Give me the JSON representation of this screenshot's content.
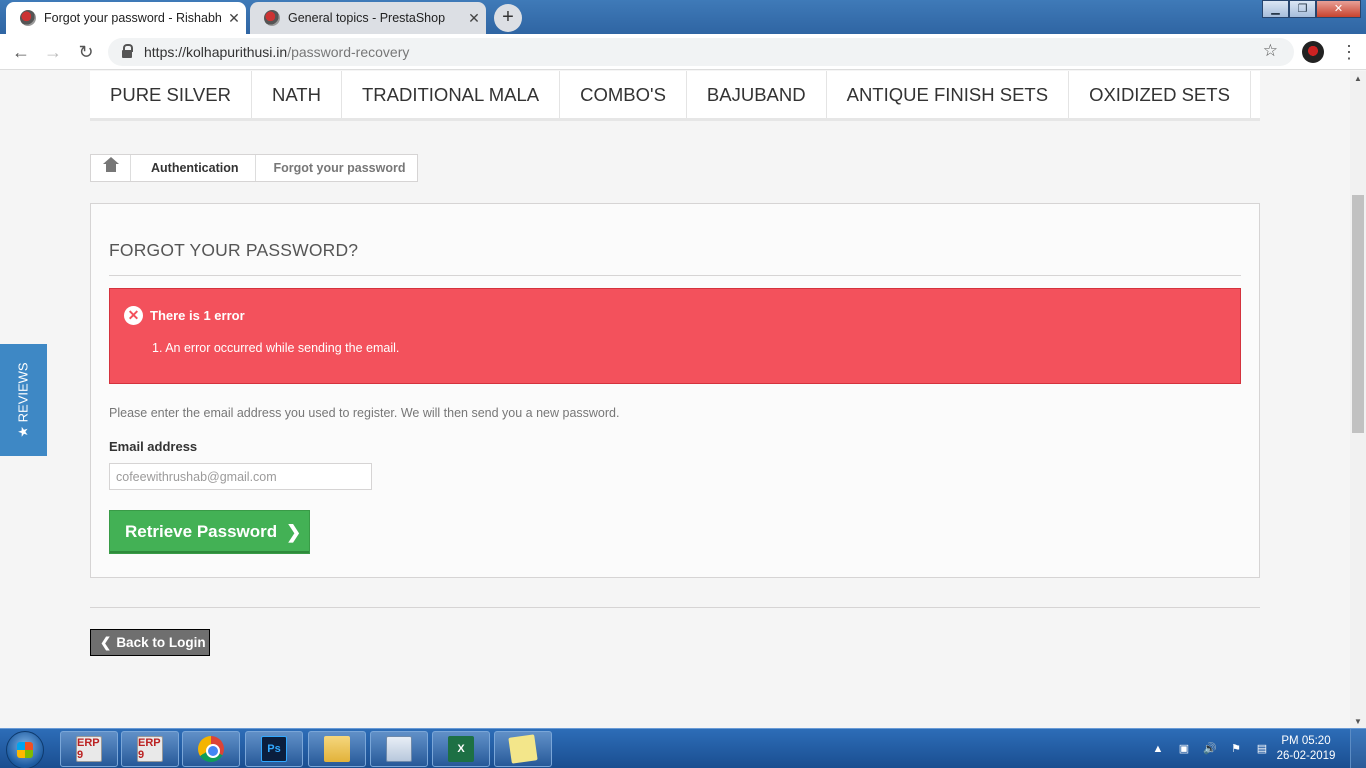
{
  "browser": {
    "tabs": [
      {
        "title": "Forgot your password - Rishabh",
        "active": true
      },
      {
        "title": "General topics - PrestaShop",
        "active": false
      }
    ],
    "new_tab": "+",
    "url_host": "https://kolhapurithusi.in",
    "url_path": "/password-recovery",
    "icons": {
      "back": "back-arrow-icon",
      "forward": "forward-arrow-icon",
      "reload": "reload-icon",
      "bookmark": "star-icon"
    }
  },
  "site": {
    "menu": [
      "PURE SILVER",
      "NATH",
      "TRADITIONAL MALA",
      "COMBO'S",
      "BAJUBAND",
      "ANTIQUE FINISH SETS",
      "OXIDIZED SETS"
    ],
    "breadcrumb": {
      "home_icon": "home-icon",
      "items": [
        "Authentication",
        "Forgot your password"
      ]
    },
    "heading": "FORGOT YOUR PASSWORD?",
    "error": {
      "title": "There is 1 error",
      "message": "1. An error occurred while sending the email."
    },
    "instructions": "Please enter the email address you used to register. We will then send you a new password.",
    "email_label": "Email address",
    "email_value": "cofeewithrushab@gmail.com",
    "retrieve_label": "Retrieve Password",
    "back_label": "Back to Login",
    "reviews_tab": "★ REVIEWS"
  },
  "colors": {
    "error": "#f3515c",
    "primary_button": "#43b155",
    "reviews_tab": "#3e88c5"
  },
  "taskbar": {
    "apps": [
      {
        "name": "tally-erp-icon",
        "label": "ERP 9"
      },
      {
        "name": "tally-erp-icon",
        "label": "ERP 9"
      },
      {
        "name": "chrome-icon",
        "label": ""
      },
      {
        "name": "photoshop-icon",
        "label": "Ps"
      },
      {
        "name": "file-explorer-icon",
        "label": ""
      },
      {
        "name": "calculator-icon",
        "label": ""
      },
      {
        "name": "excel-icon",
        "label": "X"
      },
      {
        "name": "sticky-notes-icon",
        "label": ""
      }
    ],
    "time": "PM 05:20",
    "date": "26-02-2019"
  }
}
